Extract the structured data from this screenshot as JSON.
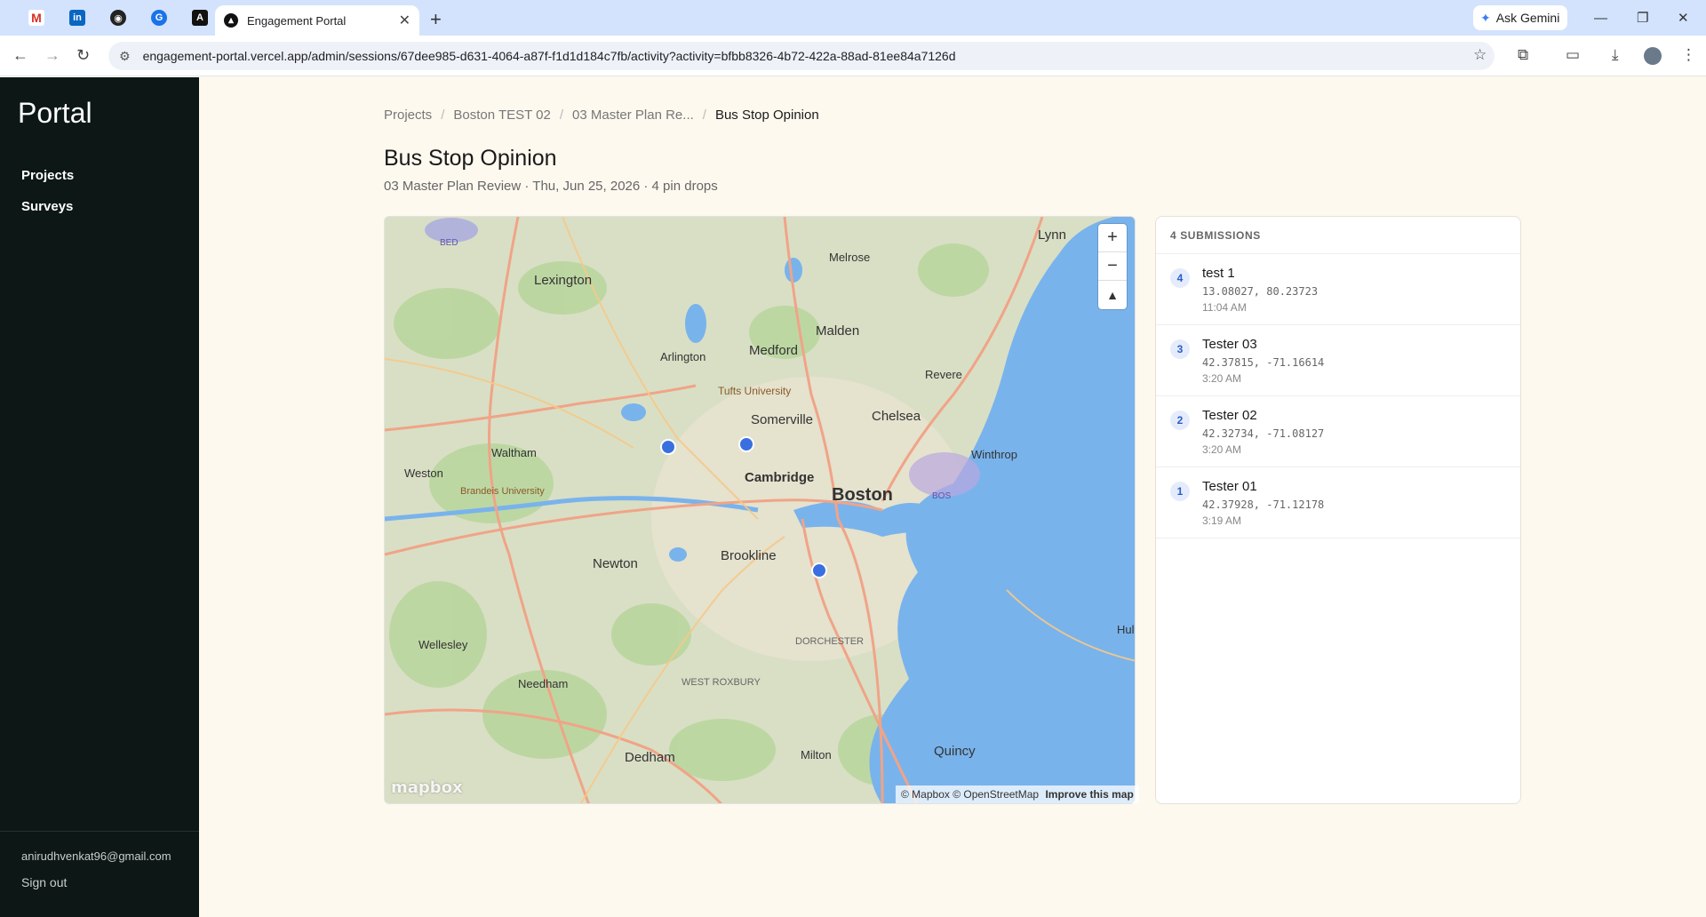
{
  "browser": {
    "tab_title": "Engagement Portal",
    "url": "engagement-portal.vercel.app/admin/sessions/67dee985-d631-4064-a87f-f1d1d184c7fb/activity?activity=bfbb8326-4b72-422a-88ad-81ee84a7126d",
    "gemini_label": "Ask Gemini",
    "pinned_icons": [
      "gmail-icon",
      "linkedin-icon",
      "github-icon",
      "grammarly-icon",
      "anthropic-icon"
    ]
  },
  "sidebar": {
    "brand": "Portal",
    "items": [
      {
        "label": "Projects"
      },
      {
        "label": "Surveys"
      }
    ],
    "email": "anirudhvenkat96@gmail.com",
    "sign_out": "Sign out"
  },
  "breadcrumb": {
    "items": [
      "Projects",
      "Boston TEST 02",
      "03 Master Plan Re...",
      "Bus Stop Opinion"
    ]
  },
  "page": {
    "title": "Bus Stop Opinion",
    "subtitle": "03 Master Plan Review · Thu, Jun 25, 2026 · 4 pin drops"
  },
  "map": {
    "labels": {
      "lexington": "Lexington",
      "melrose": "Melrose",
      "lynn": "Lynn",
      "malden": "Malden",
      "medford": "Medford",
      "arlington": "Arlington",
      "tufts": "Tufts University",
      "revere": "Revere",
      "somerville": "Somerville",
      "chelsea": "Chelsea",
      "waltham": "Waltham",
      "weston": "Weston",
      "brandeis": "Brandeis University",
      "cambridge": "Cambridge",
      "boston": "Boston",
      "winthrop": "Winthrop",
      "bos": "BOS",
      "newton": "Newton",
      "brookline": "Brookline",
      "dorchester": "DORCHESTER",
      "wellesley": "Wellesley",
      "needham": "Needham",
      "west_roxbury": "WEST ROXBURY",
      "dedham": "Dedham",
      "milton": "Milton",
      "quincy": "Quincy",
      "hull": "Hul",
      "bed": "BED"
    },
    "attribution": "© Mapbox © OpenStreetMap",
    "improve": "Improve this map",
    "logo": "mapbox",
    "controls": {
      "zoom_in": "+",
      "zoom_out": "−",
      "compass": "▲"
    },
    "pin_color": "#3a6fe0"
  },
  "submissions": {
    "header": "4 SUBMISSIONS",
    "items": [
      {
        "num": "4",
        "name": "test 1",
        "coords": "13.08027, 80.23723",
        "time": "11:04 AM"
      },
      {
        "num": "3",
        "name": "Tester 03",
        "coords": "42.37815, -71.16614",
        "time": "3:20 AM"
      },
      {
        "num": "2",
        "name": "Tester 02",
        "coords": "42.32734, -71.08127",
        "time": "3:20 AM"
      },
      {
        "num": "1",
        "name": "Tester 01",
        "coords": "42.37928, -71.12178",
        "time": "3:19 AM"
      }
    ]
  }
}
